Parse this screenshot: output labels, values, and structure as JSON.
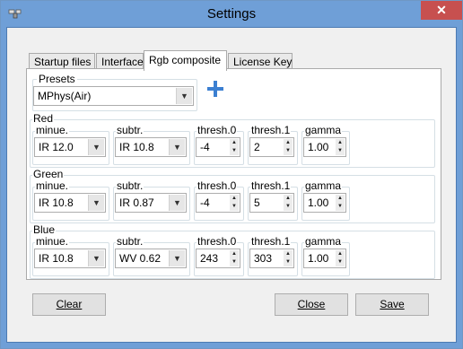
{
  "window": {
    "title": "Settings",
    "close_glyph": "✕"
  },
  "tabs": [
    {
      "label": "Startup files",
      "active": false
    },
    {
      "label": "Interface",
      "active": false
    },
    {
      "label": "Rgb composite",
      "active": true
    },
    {
      "label": "License Key",
      "active": false
    }
  ],
  "presets": {
    "label": "Presets",
    "selected": "MPhys(Air)",
    "add_icon": "plus-icon"
  },
  "columns": {
    "minue": "minue.",
    "subtr": "subtr.",
    "thresh0": "thresh.0",
    "thresh1": "thresh.1",
    "gamma": "gamma"
  },
  "channels": [
    {
      "name": "Red",
      "minue": "IR 12.0",
      "subtr": "IR 10.8",
      "thresh0": "-4",
      "thresh1": "2",
      "gamma": "1.00"
    },
    {
      "name": "Green",
      "minue": "IR 10.8",
      "subtr": "IR 0.87",
      "thresh0": "-4",
      "thresh1": "5",
      "gamma": "1.00"
    },
    {
      "name": "Blue",
      "minue": "IR 10.8",
      "subtr": "WV 0.62",
      "thresh0": "243",
      "thresh1": "303",
      "gamma": "1.00"
    }
  ],
  "buttons": {
    "clear": "Clear",
    "close": "Close",
    "save": "Save"
  }
}
